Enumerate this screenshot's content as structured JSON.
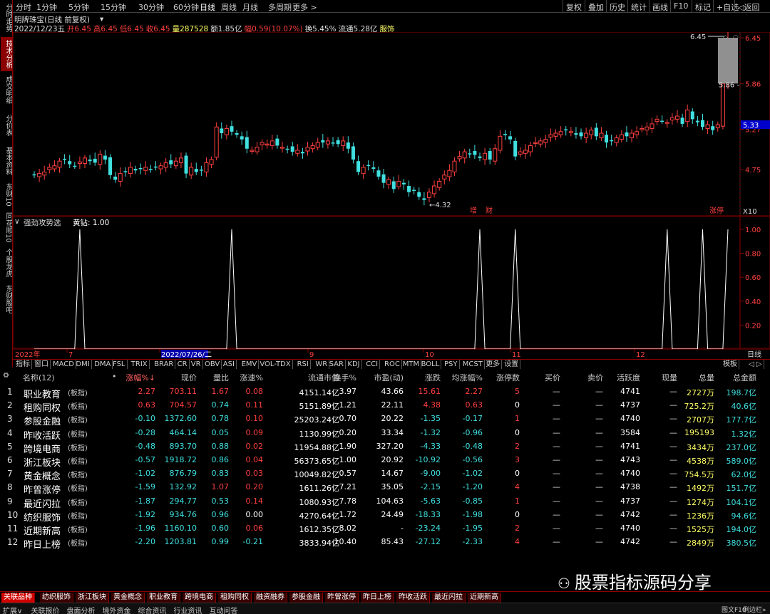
{
  "side_tabs": [
    "分时走势",
    "技术分析",
    "成交明细",
    "分价表",
    "基本资料",
    "东财10",
    "同花顺10",
    "个股龙虎",
    "东财股吧"
  ],
  "toolbar": {
    "periods": [
      "分时",
      "1分钟",
      "5分钟",
      "15分钟",
      "30分钟",
      "60分钟",
      "日线",
      "周线",
      "月线",
      "多周期",
      "更多 >"
    ],
    "right": [
      "复权",
      "叠加",
      "历史",
      "统计",
      "画线",
      "F10",
      "标记",
      "+自选",
      "◁返回"
    ]
  },
  "chart_info": {
    "title": "明牌珠宝(日线 前复权)",
    "date": "2022/12/23五",
    "open": "开6.45",
    "high": "高6.45",
    "low": "低6.45",
    "close": "收6.45",
    "vol": "量287528",
    "amt": "额1.85亿",
    "chg": "幅0.59(10.07%)",
    "turnover": "换5.45%",
    "float": "流通5.28亿",
    "sector": "服饰"
  },
  "price_axis": [
    "6.45",
    "5.86",
    "5.27",
    "4.75"
  ],
  "price_annotations": {
    "high": "6.45",
    "mid": "5.86 -",
    "low": "←4.32",
    "current": "5.33",
    "marks": [
      "增",
      "财"
    ],
    "flag": "涨停",
    "x10": "X10"
  },
  "indicator": {
    "name": "强劲攻势选",
    "label": "黄钻: 1.00",
    "axis": [
      "1.00",
      "0.80",
      "0.60",
      "0.40",
      "0.20"
    ]
  },
  "date_axis": {
    "year": "2022年",
    "labels": [
      "7",
      "2022/07/26/二",
      "9",
      "10",
      "11",
      "12"
    ],
    "right": "日线"
  },
  "indicator_tabs": [
    "指标",
    "窗口",
    "MACD",
    "DMI",
    "DMA",
    "FSL",
    "TRIX",
    "BRAR",
    "CR",
    "VR",
    "OBV",
    "ASI",
    "EMV",
    "VOL-TDX",
    "RSI",
    "WR",
    "SAR",
    "KDJ",
    "CCI",
    "ROC",
    "MTM",
    "BOLL",
    "PSY",
    "MCST",
    "更多",
    "设置"
  ],
  "indicator_tabs_right": "模板",
  "table": {
    "headers": [
      "名称(12)",
      "•",
      "涨幅%↓",
      "现价",
      "量比",
      "涨速%",
      "流通市值",
      "换手%",
      "市盈(动)",
      "涨跌",
      "均涨幅%",
      "涨停数",
      "买价",
      "卖价",
      "活跃度",
      "现量",
      "总量",
      "总金额"
    ],
    "rows": [
      [
        "1",
        "职业教育",
        "(板指)",
        "2.27",
        "703.11",
        "1.67",
        "0.08",
        "4151.14亿",
        "3.97",
        "43.66",
        "15.61",
        "2.27",
        "5",
        "—",
        "—",
        "4741",
        "—",
        "2727万",
        "198.7亿"
      ],
      [
        "2",
        "租购同权",
        "(板指)",
        "0.63",
        "704.57",
        "0.74",
        "0.11",
        "5151.89亿",
        "1.21",
        "22.11",
        "4.38",
        "0.63",
        "0",
        "—",
        "—",
        "4737",
        "—",
        "725.2万",
        "40.6亿"
      ],
      [
        "3",
        "参股金融",
        "(板指)",
        "-0.10",
        "1372.60",
        "0.78",
        "0.10",
        "25203.24亿",
        "0.70",
        "20.22",
        "-1.35",
        "-0.17",
        "1",
        "—",
        "—",
        "4740",
        "—",
        "2707万",
        "177.7亿"
      ],
      [
        "4",
        "昨收活跃",
        "(板指)",
        "-0.28",
        "464.14",
        "0.05",
        "0.09",
        "1130.99亿",
        "0.20",
        "33.34",
        "-1.32",
        "-0.96",
        "0",
        "—",
        "—",
        "3584",
        "—",
        "195193",
        "1.32亿"
      ],
      [
        "5",
        "跨境电商",
        "(板指)",
        "-0.48",
        "893.70",
        "0.88",
        "0.02",
        "11954.88亿",
        "1.90",
        "327.20",
        "-4.33",
        "-0.48",
        "2",
        "—",
        "—",
        "4741",
        "—",
        "3434万",
        "237.0亿"
      ],
      [
        "6",
        "浙江板块",
        "(板指)",
        "-0.57",
        "1918.72",
        "0.86",
        "0.04",
        "56373.65亿",
        "1.00",
        "20.92",
        "-10.92",
        "-0.56",
        "3",
        "—",
        "—",
        "4743",
        "—",
        "4538万",
        "589.0亿"
      ],
      [
        "7",
        "黄金概念",
        "(板指)",
        "-1.02",
        "876.79",
        "0.83",
        "0.03",
        "10049.82亿",
        "0.57",
        "14.67",
        "-9.00",
        "-1.02",
        "0",
        "—",
        "—",
        "4740",
        "—",
        "754.5万",
        "62.0亿"
      ],
      [
        "8",
        "昨曾涨停",
        "(板指)",
        "-1.59",
        "132.92",
        "1.07",
        "0.20",
        "1611.26亿",
        "7.21",
        "35.05",
        "-2.15",
        "-1.20",
        "4",
        "—",
        "—",
        "4738",
        "—",
        "1492万",
        "151.7亿"
      ],
      [
        "9",
        "最近闪拉",
        "(板指)",
        "-1.87",
        "294.77",
        "0.53",
        "0.14",
        "1080.93亿",
        "7.78",
        "104.63",
        "-5.63",
        "-0.85",
        "1",
        "—",
        "—",
        "4737",
        "—",
        "1274万",
        "104.1亿"
      ],
      [
        "10",
        "纺织服饰",
        "(板指)",
        "-1.92",
        "934.76",
        "0.96",
        "0.00",
        "4270.64亿",
        "1.72",
        "24.49",
        "-18.33",
        "-1.98",
        "0",
        "—",
        "—",
        "4742",
        "—",
        "1236万",
        "94.6亿"
      ],
      [
        "11",
        "近期新高",
        "(板指)",
        "-1.96",
        "1160.10",
        "0.60",
        "0.06",
        "1612.35亿",
        "8.02",
        "-",
        "-23.24",
        "-1.95",
        "2",
        "—",
        "—",
        "4740",
        "—",
        "1525万",
        "194.0亿"
      ],
      [
        "12",
        "昨日上榜",
        "(板指)",
        "-2.20",
        "1203.81",
        "0.99",
        "-0.21",
        "3833.94亿",
        "10.40",
        "85.43",
        "-27.12",
        "-2.33",
        "4",
        "—",
        "—",
        "4742",
        "—",
        "2849万",
        "380.5亿"
      ]
    ]
  },
  "bottom_tabs": [
    "关联品种",
    "纺织服饰",
    "浙江板块",
    "黄金概念",
    "职业教育",
    "跨境电商",
    "租购同权",
    "融资融券",
    "参股金融",
    "昨曾涨停",
    "昨日上榜",
    "昨收活跃",
    "最近闪拉",
    "近期新高"
  ],
  "status": [
    "扩展∨",
    "关联报价",
    "盘面分析",
    "境外资金",
    "综合资讯",
    "行业资讯",
    "互动问答"
  ],
  "status_right": [
    "图文F10",
    "例边栏»"
  ],
  "watermark": "股票指标源码分享",
  "colors": {
    "up": "#ff4040",
    "down": "#40e0e0",
    "flat": "#ffffff",
    "frame": "#8b0000",
    "yellow": "#ffff00",
    "vol": "#ffff66"
  }
}
